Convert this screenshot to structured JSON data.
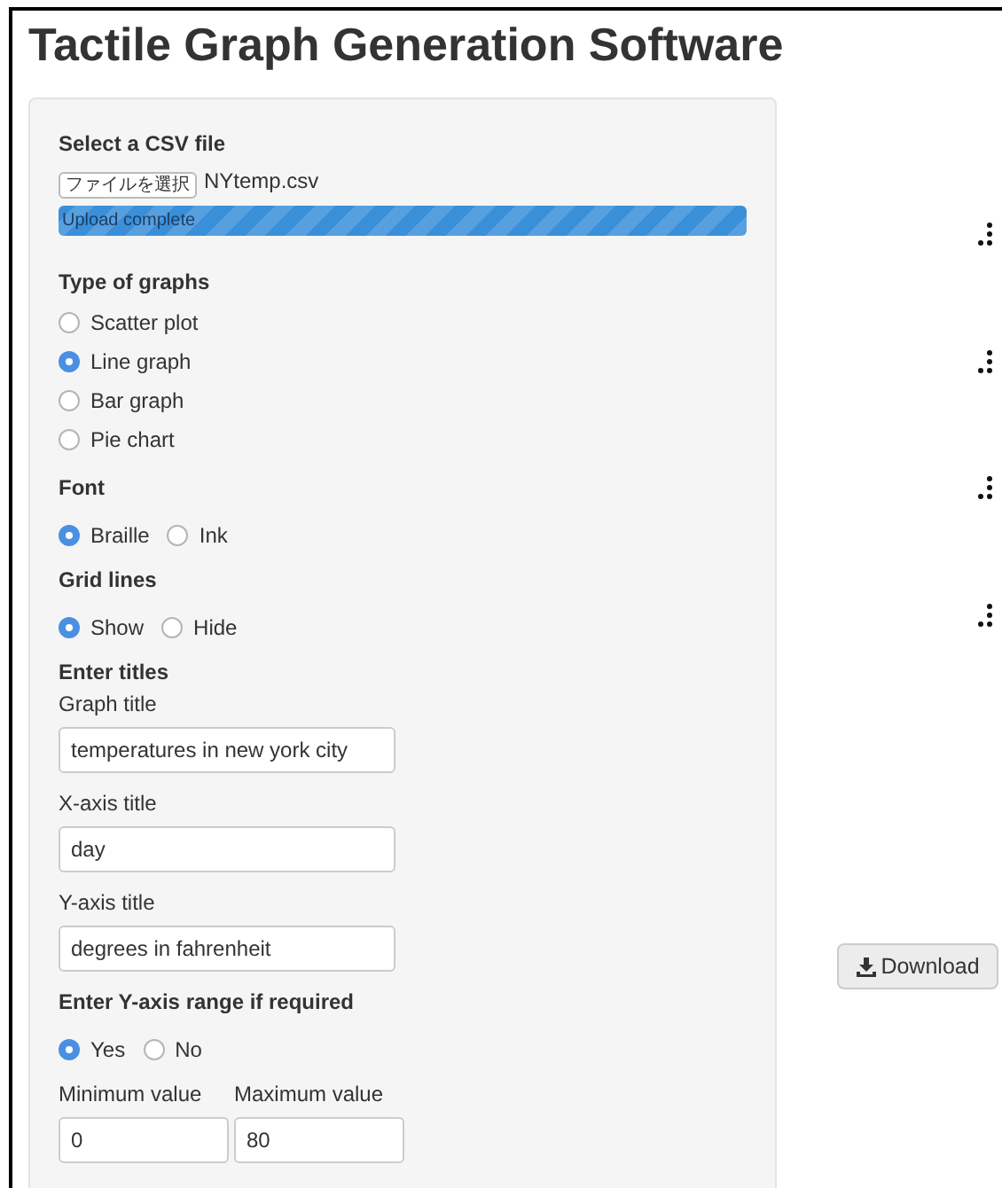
{
  "title": "Tactile Graph Generation Software",
  "file_input": {
    "label": "Select a CSV file",
    "button_label": "ファイルを選択",
    "file_name": "NYtemp.csv",
    "progress": {
      "label": "Upload complete",
      "level": 1
    }
  },
  "graph_type": {
    "label": "Type of graphs",
    "options": [
      {
        "label": "Scatter plot",
        "selected": false
      },
      {
        "label": "Line graph",
        "selected": true
      },
      {
        "label": "Bar graph",
        "selected": false
      },
      {
        "label": "Pie chart",
        "selected": false
      }
    ]
  },
  "font": {
    "label": "Font",
    "options": [
      {
        "label": "Braille",
        "selected": true
      },
      {
        "label": "Ink",
        "selected": false
      }
    ]
  },
  "grid_lines": {
    "label": "Grid lines",
    "options": [
      {
        "label": "Show",
        "selected": true
      },
      {
        "label": "Hide",
        "selected": false
      }
    ]
  },
  "titles": {
    "label": "Enter titles",
    "fields": [
      {
        "label": "Graph title",
        "value": "temperatures in new york city"
      },
      {
        "label": "X-axis title",
        "value": "day"
      },
      {
        "label": "Y-axis title",
        "value": "degrees in fahrenheit"
      }
    ]
  },
  "y_range": {
    "label": "Enter Y-axis range if required",
    "options": [
      {
        "label": "Yes",
        "selected": true
      },
      {
        "label": "No",
        "selected": false
      }
    ],
    "fields": [
      {
        "label": "Minimum value",
        "value": "0"
      },
      {
        "label": "Maximum value",
        "value": "80"
      }
    ]
  },
  "download_button": "Download"
}
